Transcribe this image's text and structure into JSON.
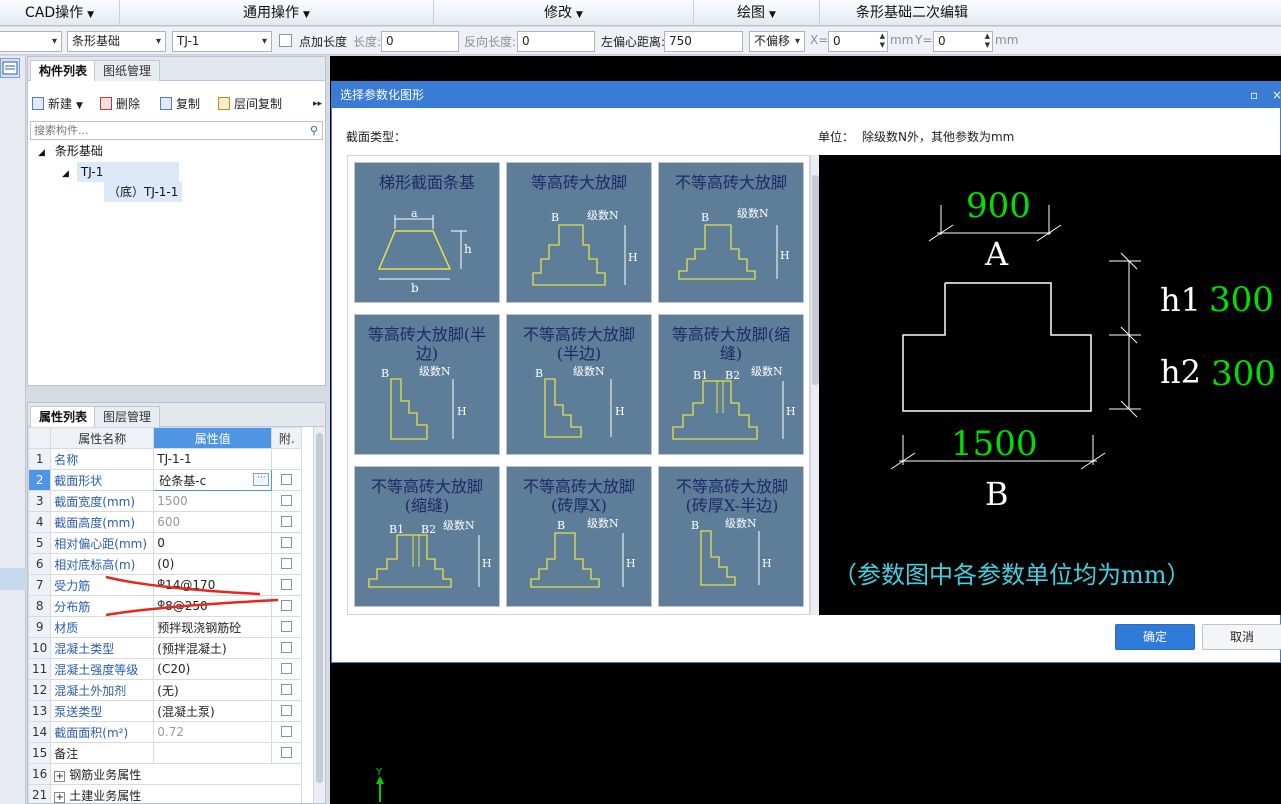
{
  "menubar": {
    "items": [
      "CAD操作",
      "通用操作",
      "修改",
      "绘图",
      "条形基础二次编辑"
    ]
  },
  "toolbar": {
    "layer_select": "",
    "type_select": "条形基础",
    "name_select": "TJ-1",
    "point_length_label": "点加长度",
    "length_label": "长度:",
    "length_value": "0",
    "reverse_length_label": "反向长度:",
    "reverse_length_value": "0",
    "left_offset_label": "左偏心距离:",
    "left_offset_value": "750",
    "offset_mode": "不偏移",
    "x_label": "X=",
    "x_value": "0",
    "y_label": "Y=",
    "y_value": "0",
    "unit": "mm"
  },
  "component_panel": {
    "tabs": [
      "构件列表",
      "图纸管理"
    ],
    "actions": [
      "新建",
      "删除",
      "复制",
      "层间复制"
    ],
    "search_placeholder": "搜索构件...",
    "tree": {
      "root": "条形基础",
      "child": "TJ-1",
      "leaf": "（底）TJ-1-1"
    }
  },
  "property_panel": {
    "tabs": [
      "属性列表",
      "图层管理"
    ],
    "headers": [
      "属性名称",
      "属性值",
      "附."
    ],
    "rows": [
      {
        "num": "1",
        "name": "名称",
        "value": "TJ-1-1"
      },
      {
        "num": "2",
        "name": "截面形状",
        "value": "砼条基-c"
      },
      {
        "num": "3",
        "name": "截面宽度(mm)",
        "value": "1500"
      },
      {
        "num": "4",
        "name": "截面高度(mm)",
        "value": "600"
      },
      {
        "num": "5",
        "name": "相对偏心距(mm)",
        "value": "0"
      },
      {
        "num": "6",
        "name": "相对底标高(m)",
        "value": "(0)"
      },
      {
        "num": "7",
        "name": "受力筋",
        "value": "14@170"
      },
      {
        "num": "8",
        "name": "分布筋",
        "value": "8@250"
      },
      {
        "num": "9",
        "name": "材质",
        "value": "预拌现浇钢筋砼"
      },
      {
        "num": "10",
        "name": "混凝土类型",
        "value": "(预拌混凝土)"
      },
      {
        "num": "11",
        "name": "混凝土强度等级",
        "value": "(C20)"
      },
      {
        "num": "12",
        "name": "混凝土外加剂",
        "value": "(无)"
      },
      {
        "num": "13",
        "name": "泵送类型",
        "value": "(混凝土泵)"
      },
      {
        "num": "14",
        "name": "截面面积(m²)",
        "value": "0.72"
      },
      {
        "num": "15",
        "name": "备注",
        "value": ""
      },
      {
        "num": "16",
        "name": "钢筋业务属性",
        "value": ""
      },
      {
        "num": "21",
        "name": "土建业务属性",
        "value": ""
      }
    ],
    "rebar_symbol": "Φ"
  },
  "dialog": {
    "title": "选择参数化图形",
    "section_label": "截面类型：",
    "unit_label": "单位：",
    "unit_note": "除级数N外，其他参数为mm",
    "shapes": [
      "梯形截面条基",
      "等高砖大放脚",
      "不等高砖大放脚",
      "等高砖大放脚(半边)",
      "不等高砖大放脚(半边)",
      "等高砖大放脚(缩缝)",
      "不等高砖大放脚(缩缝)",
      "不等高砖大放脚(砖厚X)",
      "不等高砖大放脚(砖厚X-半边)"
    ],
    "shape_labels": {
      "a": "a",
      "b": "b",
      "h": "h",
      "B": "B",
      "H": "H",
      "N": "级数N",
      "B1": "B1",
      "B2": "B2"
    },
    "preview": {
      "top_value": "900",
      "top_label": "A",
      "h1_label": "h1",
      "h1_value": "300",
      "h2_label": "h2",
      "h2_value": "300",
      "bottom_value": "1500",
      "bottom_label": "B",
      "note": "（参数图中各参数单位均为mm）"
    },
    "ok_label": "确定",
    "cancel_label": "取消"
  },
  "cad": {
    "axis_label": "Y"
  },
  "colors": {
    "dialog_title_bg": "#3a7bd5",
    "shape_bg": "#5d7d99",
    "preview_green": "#00e000",
    "preview_cyan": "#40d0e0",
    "annotation_red": "#e8261c",
    "ok_button": "#2f7ad8"
  }
}
